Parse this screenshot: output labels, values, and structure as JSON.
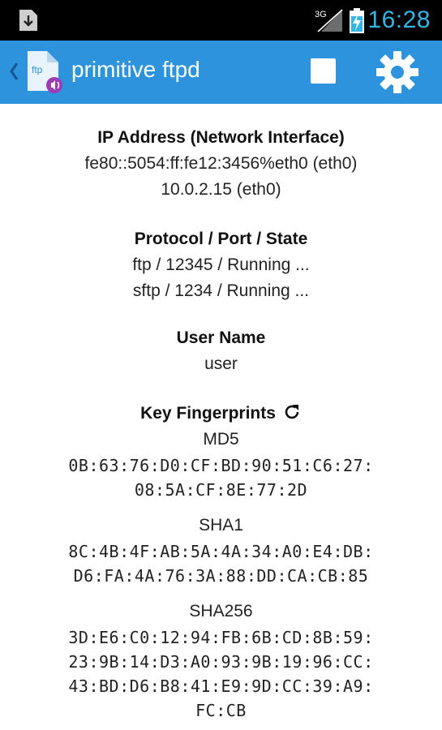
{
  "status_bar": {
    "network_label": "3G",
    "time": "16:28",
    "accent_color": "#33b5e5",
    "icons": [
      "download-notification-icon",
      "signal-3g-icon",
      "battery-charging-icon"
    ]
  },
  "action_bar": {
    "title": "primitive ftpd",
    "app_icon_label": "ftp",
    "background_color": "#2c93dc",
    "icons": [
      "up-caret-icon",
      "app-icon",
      "stop-icon",
      "settings-gear-icon"
    ]
  },
  "sections": {
    "ip": {
      "title": "IP Address (Network Interface)",
      "values": [
        "fe80::5054:ff:fe12:3456%eth0 (eth0)",
        "10.0.2.15 (eth0)"
      ]
    },
    "protocol": {
      "title": "Protocol / Port / State",
      "values": [
        "ftp / 12345 / Running ...",
        "sftp / 1234 / Running ..."
      ]
    },
    "user": {
      "title": "User Name",
      "value": "user"
    },
    "fingerprints": {
      "title": "Key Fingerprints",
      "md5": {
        "label": "MD5",
        "lines": [
          "0B:63:76:D0:CF:BD:90:51:C6:27:",
          "08:5A:CF:8E:77:2D"
        ]
      },
      "sha1": {
        "label": "SHA1",
        "lines": [
          "8C:4B:4F:AB:5A:4A:34:A0:E4:DB:",
          "D6:FA:4A:76:3A:88:DD:CA:CB:85"
        ]
      },
      "sha256": {
        "label": "SHA256",
        "lines": [
          "3D:E6:C0:12:94:FB:6B:CD:8B:59:",
          "23:9B:14:D3:A0:93:9B:19:96:CC:",
          "43:BD:D6:B8:41:E9:9D:CC:39:A9:",
          "FC:CB"
        ]
      }
    }
  }
}
